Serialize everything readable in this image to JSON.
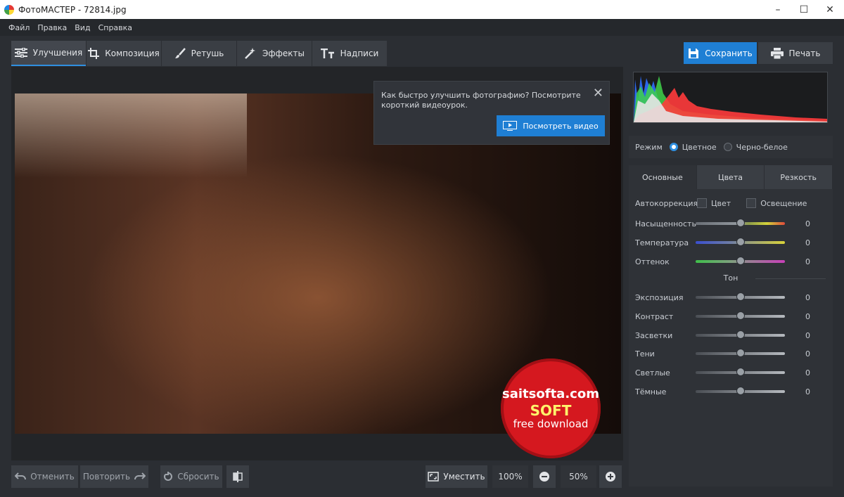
{
  "window": {
    "title": "ФотоМАСТЕР - 72814.jpg"
  },
  "menu": [
    "Файл",
    "Правка",
    "Вид",
    "Справка"
  ],
  "tabs": [
    {
      "label": "Улучшения",
      "icon": "sliders-icon"
    },
    {
      "label": "Композиция",
      "icon": "crop-icon"
    },
    {
      "label": "Ретушь",
      "icon": "brush-icon"
    },
    {
      "label": "Эффекты",
      "icon": "magic-wand-icon"
    },
    {
      "label": "Надписи",
      "icon": "text-icon"
    }
  ],
  "actions": {
    "save": "Сохранить",
    "print": "Печать"
  },
  "tip": {
    "text": "Как быстро улучшить фотографию? Посмотрите короткий видеоурок.",
    "button": "Посмотреть видео"
  },
  "watermark": {
    "line1": "saitsofta.com",
    "line2": "SOFT",
    "line3": "free download"
  },
  "bottom": {
    "undo": "Отменить",
    "redo": "Повторить",
    "reset": "Сбросить",
    "fit": "Уместить",
    "zoom100": "100%",
    "zoom_value": "50%"
  },
  "mode": {
    "label": "Режим",
    "color": "Цветное",
    "bw": "Черно-белое",
    "selected": "color"
  },
  "subtabs": [
    "Основные",
    "Цвета",
    "Резкость"
  ],
  "auto": {
    "label": "Автокоррекция",
    "color": "Цвет",
    "light": "Освещение"
  },
  "sliders": [
    {
      "label": "Насыщенность",
      "value": "0",
      "level": 0.5
    },
    {
      "label": "Температура",
      "value": "0",
      "level": 0.5
    },
    {
      "label": "Оттенок",
      "value": "0",
      "level": 0.5
    }
  ],
  "tone": {
    "title": "Тон",
    "sliders": [
      {
        "label": "Экспозиция",
        "value": "0",
        "level": 0.5
      },
      {
        "label": "Контраст",
        "value": "0",
        "level": 0.5
      },
      {
        "label": "Засветки",
        "value": "0",
        "level": 0.5
      },
      {
        "label": "Тени",
        "value": "0",
        "level": 0.5
      },
      {
        "label": "Светлые",
        "value": "0",
        "level": 0.5
      },
      {
        "label": "Тёмные",
        "value": "0",
        "level": 0.5
      }
    ]
  },
  "colors": {
    "accent": "#1f7fd4",
    "panel": "#2f3237",
    "background": "#2b2e33"
  }
}
